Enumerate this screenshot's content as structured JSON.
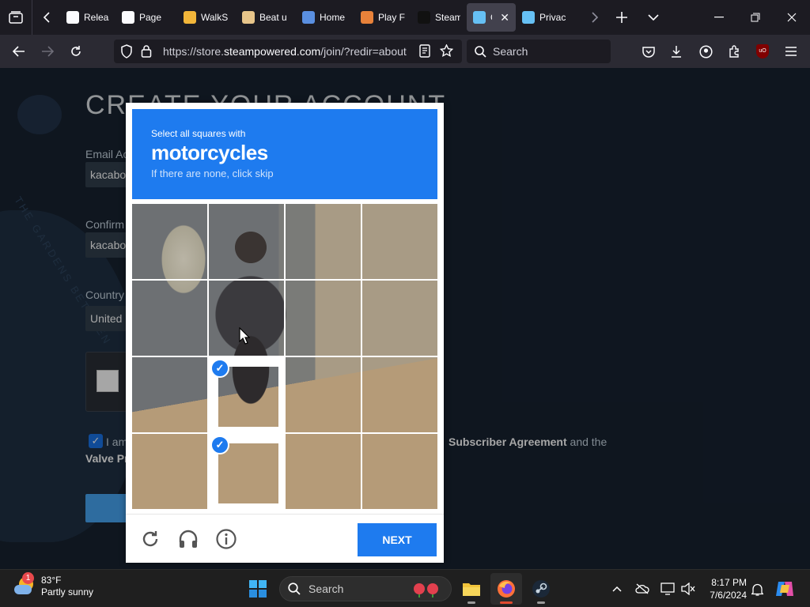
{
  "browser": {
    "tabs": [
      {
        "label": "Releas",
        "favicon": "arrow-icon"
      },
      {
        "label": "Page",
        "favicon": "github-icon"
      },
      {
        "label": "WalkS",
        "favicon": "walk-icon"
      },
      {
        "label": "Beat u",
        "favicon": "peanut-icon"
      },
      {
        "label": "Home",
        "favicon": "home-icon"
      },
      {
        "label": "Play F",
        "favicon": "tiger-icon"
      },
      {
        "label": "Steam",
        "favicon": "steamdb-icon"
      },
      {
        "label": "Cre",
        "favicon": "steam-icon",
        "active": true
      },
      {
        "label": "Privac",
        "favicon": "steam-icon"
      }
    ],
    "url_prefix": "https://store.",
    "url_domain": "steampowered.com",
    "url_path": "/join/?redir=about",
    "search_placeholder": "Search"
  },
  "page": {
    "title": "CREATE YOUR ACCOUNT",
    "email_label": "Email Ac",
    "email_value": "kacabo",
    "confirm_label": "Confirm",
    "confirm_value": "kacabo",
    "country_label": "Country",
    "country_value": "United",
    "agree_prefix": "I am",
    "agree_link1": "Subscriber Agreement",
    "agree_mid": "and the",
    "agree_link2": "Valve Pr",
    "bg_text": "THE GARDENS BETWEEN"
  },
  "captcha": {
    "instruction": "Select all squares with",
    "target": "motorcycles",
    "hint": "If there are none, click skip",
    "selected_tiles": [
      9,
      13
    ],
    "next_label": "NEXT"
  },
  "taskbar": {
    "temperature": "83°F",
    "condition": "Partly sunny",
    "weather_badge": "1",
    "search_placeholder": "Search",
    "time": "8:17 PM",
    "date": "7/6/2024"
  }
}
